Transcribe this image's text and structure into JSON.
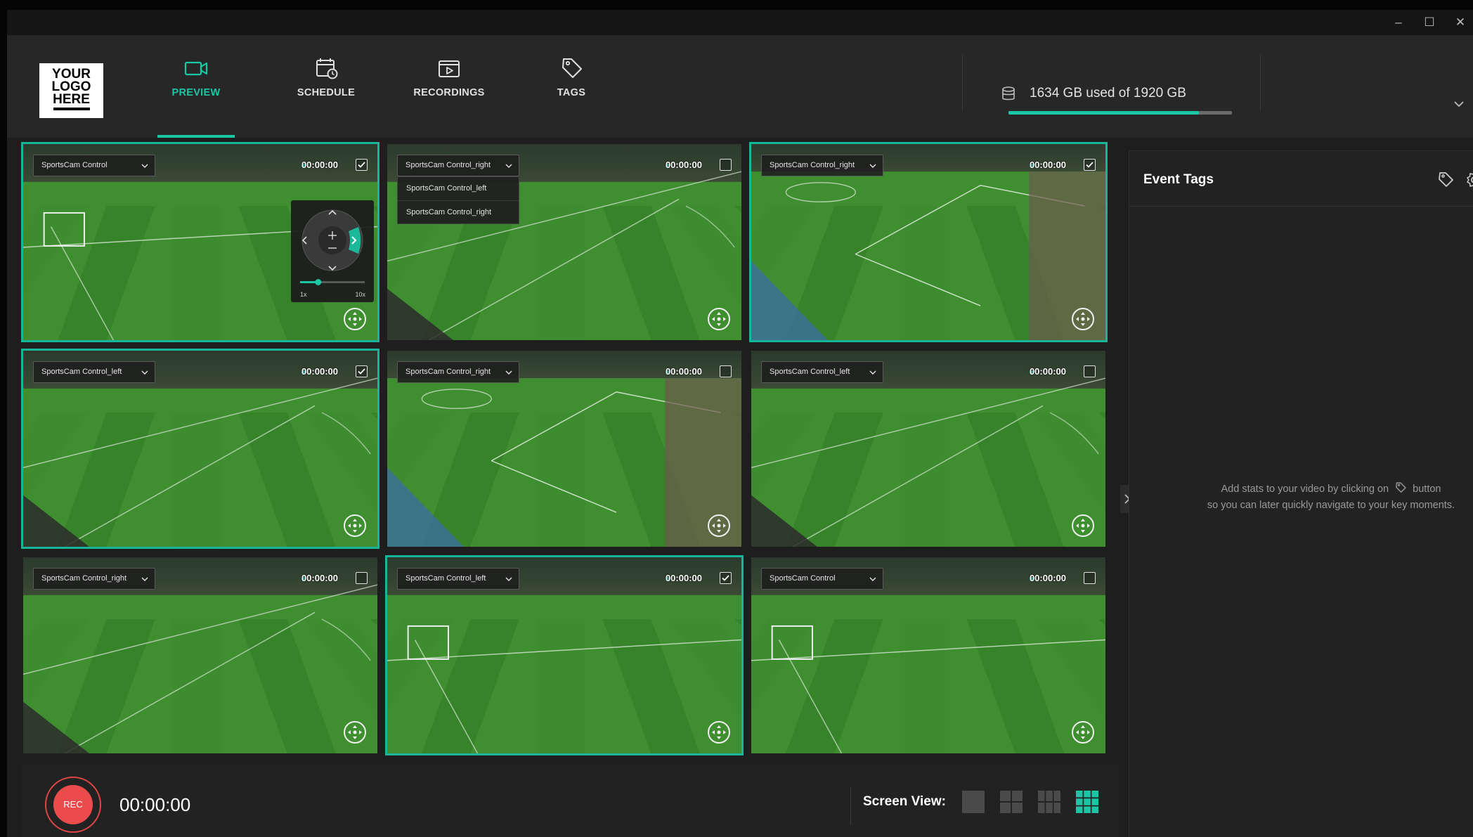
{
  "window": {
    "controls": {
      "minimize": "–",
      "maximize": "☐",
      "close": "✕"
    }
  },
  "logo": {
    "lines": [
      "YOUR",
      "LOGO",
      "HERE"
    ]
  },
  "nav": {
    "tabs": [
      {
        "label": "PREVIEW",
        "icon": "video-camera-icon",
        "active": true
      },
      {
        "label": "SCHEDULE",
        "icon": "calendar-clock-icon",
        "active": false
      },
      {
        "label": "RECORDINGS",
        "icon": "recordings-icon",
        "active": false
      },
      {
        "label": "TAGS",
        "icon": "tag-icon",
        "active": false
      }
    ]
  },
  "storage": {
    "text": "1634 GB used of 1920 GB",
    "used_fraction": 0.851
  },
  "cameras": [
    {
      "name": "SportsCam Control",
      "time": "00:00:00",
      "checked": true,
      "selected": true,
      "ptz_panel": true
    },
    {
      "name": "SportsCam Control_right",
      "time": "00:00:00",
      "checked": false,
      "selected": false,
      "dropdown_open": true
    },
    {
      "name": "SportsCam Control_right",
      "time": "00:00:00",
      "checked": true,
      "selected": true
    },
    {
      "name": "SportsCam Control_left",
      "time": "00:00:00",
      "checked": true,
      "selected": true
    },
    {
      "name": "SportsCam Control_right",
      "time": "00:00:00",
      "checked": false,
      "selected": false
    },
    {
      "name": "SportsCam Control_left",
      "time": "00:00:00",
      "checked": false,
      "selected": false
    },
    {
      "name": "SportsCam Control_right",
      "time": "00:00:00",
      "checked": false,
      "selected": false
    },
    {
      "name": "SportsCam Control_left",
      "time": "00:00:00",
      "checked": true,
      "selected": true
    },
    {
      "name": "SportsCam Control",
      "time": "00:00:00",
      "checked": false,
      "selected": false
    }
  ],
  "dropdown": {
    "options": [
      "SportsCam Control_left",
      "SportsCam Control_right"
    ]
  },
  "ptz": {
    "zoom_min": "1x",
    "zoom_max": "10x",
    "zoom_level": 0.28
  },
  "record": {
    "button_label": "REC",
    "timer": "00:00:00"
  },
  "screen_view": {
    "label": "Screen View:",
    "options": [
      "single-view-icon",
      "grid-2x2-icon",
      "grid-3x2-icon",
      "grid-3x3-icon"
    ],
    "active_index": 3
  },
  "event_tags": {
    "title": "Event Tags",
    "empty_line1_before": "Add stats to your video by clicking on",
    "empty_line1_after": "button",
    "empty_line2": "so you can later quickly navigate to your key moments."
  },
  "colors": {
    "accent": "#19c7a5",
    "record": "#ec4b4b",
    "background": "#1e1e1e"
  }
}
